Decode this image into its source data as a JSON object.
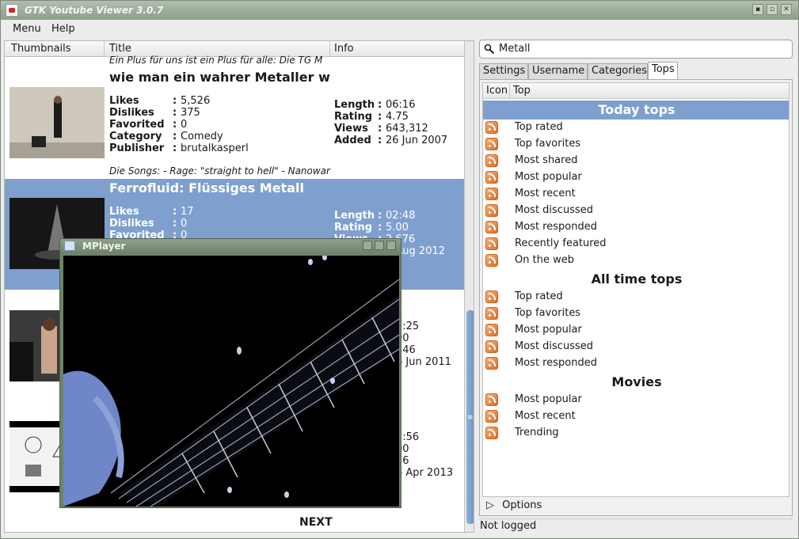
{
  "window": {
    "title": "GTK Youtube Viewer 3.0.7"
  },
  "menu": [
    "Menu",
    "Help"
  ],
  "results": {
    "columns": [
      "Thumbnails",
      "Title",
      "Info"
    ],
    "labels": {
      "likes": "Likes",
      "dislikes": "Dislikes",
      "favorited": "Favorited",
      "category": "Category",
      "publisher": "Publisher",
      "length": "Length",
      "rating": "Rating",
      "views": "Views",
      "added": "Added"
    },
    "prev_desc": "Ein Plus für uns ist ein Plus für alle: Die TG M",
    "videos": [
      {
        "title": "wie man ein wahrer Metaller wird",
        "likes": "5,526",
        "dislikes": "375",
        "favorited": "0",
        "category": "Comedy",
        "publisher": "brutalkasperl",
        "length": "06:16",
        "rating": "4.75",
        "views": "643,312",
        "added": "26 Jun 2007",
        "desc": "Die Songs: - Rage: \"straight to hell\" - Nanowar"
      },
      {
        "title": "Ferrofluid: Flüssiges Metall",
        "likes": "17",
        "dislikes": "0",
        "favorited": "0",
        "length": "02:48",
        "rating": "5.00",
        "views": "2,676",
        "added": "9 Aug 2012",
        "selected": true
      },
      {
        "length_partial": "5:25",
        "rating_partial": "00",
        "views_partial": "346",
        "added_partial": "6 Jun 2011"
      },
      {
        "length_partial": "1:56",
        "rating_partial": "00",
        "views_partial": "76",
        "added_partial": "6 Apr 2013"
      }
    ],
    "next_label": "NEXT"
  },
  "search": {
    "value": "Metall"
  },
  "tabs": [
    "Settings",
    "Username",
    "Categories",
    "Tops"
  ],
  "active_tab": "Tops",
  "tops": {
    "columns": [
      "Icon",
      "Top"
    ],
    "groups": [
      {
        "name": "Today tops",
        "items": [
          "Top rated",
          "Top favorites",
          "Most shared",
          "Most popular",
          "Most recent",
          "Most discussed",
          "Most responded",
          "Recently featured",
          "On the web"
        ]
      },
      {
        "name": "All time tops",
        "items": [
          "Top rated",
          "Top favorites",
          "Most popular",
          "Most discussed",
          "Most responded"
        ]
      },
      {
        "name": "Movies",
        "items": [
          "Most popular",
          "Most recent",
          "Trending"
        ]
      }
    ],
    "options_label": "Options"
  },
  "status": "Not logged",
  "mplayer": {
    "title": "MPlayer"
  },
  "colors": {
    "selection": "#7f9fce",
    "rss": "#e36a1d"
  }
}
